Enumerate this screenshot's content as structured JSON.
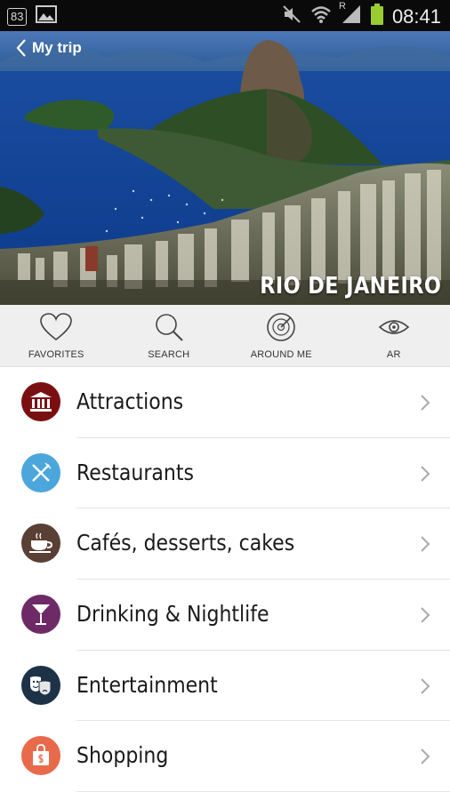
{
  "status_bar": {
    "notification_count": "83",
    "network_letter": "R",
    "time": "08:41"
  },
  "header": {
    "back_label": "My trip",
    "city_name": "RIO DE JANEIRO"
  },
  "toolbar": {
    "items": [
      {
        "label": "FAVORITES",
        "icon": "heart-icon"
      },
      {
        "label": "SEARCH",
        "icon": "search-icon"
      },
      {
        "label": "AROUND ME",
        "icon": "radar-icon"
      },
      {
        "label": "AR",
        "icon": "eye-icon"
      }
    ]
  },
  "categories": [
    {
      "label": "Attractions",
      "icon": "museum-icon",
      "color": "#7a0f12"
    },
    {
      "label": "Restaurants",
      "icon": "fork-knife-icon",
      "color": "#4ba6dc"
    },
    {
      "label": "Cafés, desserts, cakes",
      "icon": "coffee-cup-icon",
      "color": "#5a3f34"
    },
    {
      "label": "Drinking & Nightlife",
      "icon": "cocktail-icon",
      "color": "#6e2a67"
    },
    {
      "label": "Entertainment",
      "icon": "theater-masks-icon",
      "color": "#1d3247"
    },
    {
      "label": "Shopping",
      "icon": "shopping-bag-icon",
      "color": "#e86a4b"
    }
  ]
}
